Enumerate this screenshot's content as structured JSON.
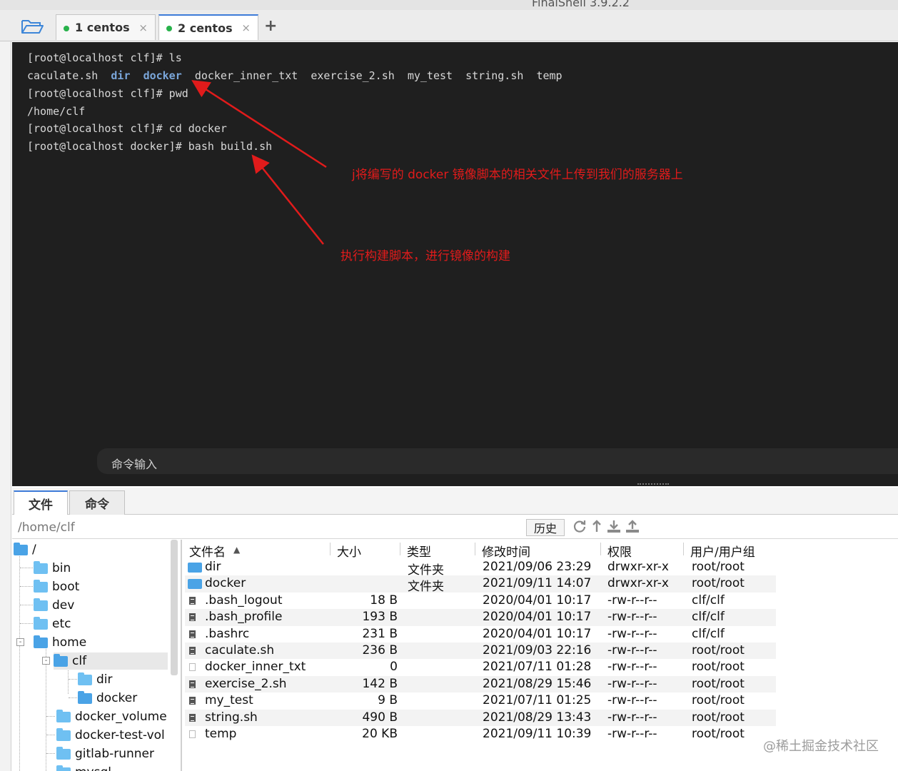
{
  "window": {
    "title": "FinalShell 3.9.2.2"
  },
  "tabs": [
    {
      "label": "1 centos"
    },
    {
      "label": "2 centos"
    }
  ],
  "tab_close_glyph": "×",
  "add_tab_glyph": "+",
  "terminal": {
    "line1": "[root@localhost clf]# ls",
    "ls_output": {
      "f1": "caculate.sh",
      "d1": "dir",
      "d2": "docker",
      "f2": "docker_inner_txt",
      "f3": "exercise_2.sh",
      "f4": "my_test",
      "f5": "string.sh",
      "f6": "temp"
    },
    "line3": "[root@localhost clf]# pwd",
    "line4": "/home/clf",
    "line5": "[root@localhost clf]# cd docker",
    "line6": "[root@localhost docker]# bash build.sh",
    "command_input_placeholder": "命令输入",
    "dir_color": "#7aa6da"
  },
  "annotations": {
    "upload_note": "j将编写的 docker 镜像脚本的相关文件上传到我们的服务器上",
    "build_note": "执行构建脚本，进行镜像的构建",
    "color": "#e11b1b"
  },
  "bottom_tabs": {
    "files": "文件",
    "commands": "命令"
  },
  "path": "/home/clf",
  "toolbar": {
    "history": "历史"
  },
  "tree": {
    "root": "/",
    "bin": "bin",
    "boot": "boot",
    "dev": "dev",
    "etc": "etc",
    "home": "home",
    "clf": "clf",
    "dir": "dir",
    "docker": "docker",
    "docker_volume": "docker_volume",
    "docker_test_vol": "docker-test-vol",
    "gitlab_runner": "gitlab-runner",
    "mysql": "mysql",
    "expander_minus": "-"
  },
  "table": {
    "sort_glyph": "▲",
    "headers": {
      "name": "文件名",
      "size": "大小",
      "type": "类型",
      "mtime": "修改时间",
      "perm": "权限",
      "owner": "用户/用户组"
    },
    "rows": [
      {
        "name": "dir",
        "size": "",
        "type": "文件夹",
        "mtime": "2021/09/06 23:29",
        "perm": "drwxr-xr-x",
        "owner": "root/root"
      },
      {
        "name": "docker",
        "size": "",
        "type": "文件夹",
        "mtime": "2021/09/11 14:07",
        "perm": "drwxr-xr-x",
        "owner": "root/root"
      },
      {
        "name": ".bash_logout",
        "size": "18 B",
        "type": "",
        "mtime": "2020/04/01 10:17",
        "perm": "-rw-r--r--",
        "owner": "clf/clf"
      },
      {
        "name": ".bash_profile",
        "size": "193 B",
        "type": "",
        "mtime": "2020/04/01 10:17",
        "perm": "-rw-r--r--",
        "owner": "clf/clf"
      },
      {
        "name": ".bashrc",
        "size": "231 B",
        "type": "",
        "mtime": "2020/04/01 10:17",
        "perm": "-rw-r--r--",
        "owner": "clf/clf"
      },
      {
        "name": "caculate.sh",
        "size": "236 B",
        "type": "",
        "mtime": "2021/09/03 22:16",
        "perm": "-rw-r--r--",
        "owner": "root/root"
      },
      {
        "name": "docker_inner_txt",
        "size": "0",
        "type": "",
        "mtime": "2021/07/11 01:28",
        "perm": "-rw-r--r--",
        "owner": "root/root"
      },
      {
        "name": "exercise_2.sh",
        "size": "142 B",
        "type": "",
        "mtime": "2021/08/29 15:46",
        "perm": "-rw-r--r--",
        "owner": "root/root"
      },
      {
        "name": "my_test",
        "size": "9 B",
        "type": "",
        "mtime": "2021/07/11 01:25",
        "perm": "-rw-r--r--",
        "owner": "root/root"
      },
      {
        "name": "string.sh",
        "size": "490 B",
        "type": "",
        "mtime": "2021/08/29 13:43",
        "perm": "-rw-r--r--",
        "owner": "root/root"
      },
      {
        "name": "temp",
        "size": "20 KB",
        "type": "",
        "mtime": "2021/09/11 10:39",
        "perm": "-rw-r--r--",
        "owner": "root/root"
      }
    ]
  },
  "watermark": "@稀土掘金技术社区",
  "icons": {
    "open_folder": "folder-open-icon",
    "refresh": "refresh-icon",
    "up": "arrow-up-icon",
    "download": "download-icon",
    "upload": "upload-icon"
  },
  "colors": {
    "accent": "#3d7bd8",
    "status_online": "#28b24b",
    "folder": "#4aa3e6"
  }
}
